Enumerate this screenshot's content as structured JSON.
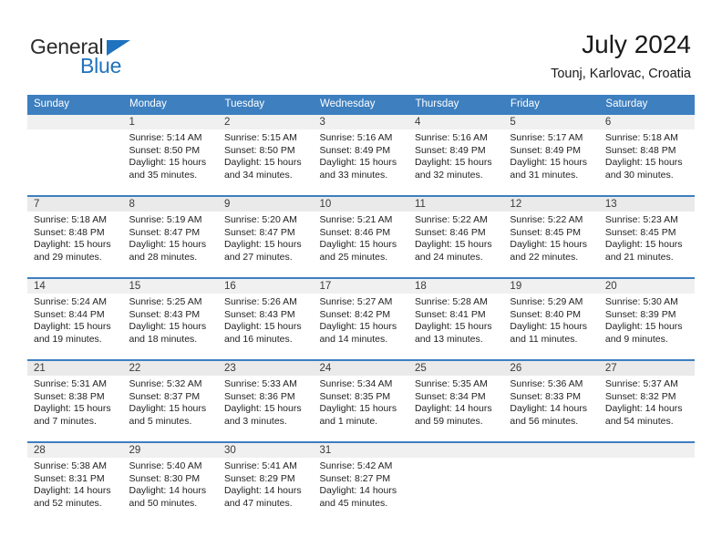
{
  "brand": {
    "name_part1": "General",
    "name_part2": "Blue",
    "accent_color": "#1f72bd"
  },
  "header": {
    "title": "July 2024",
    "subtitle": "Tounj, Karlovac, Croatia"
  },
  "calendar": {
    "header_color": "#3d7fbf",
    "weekdays": [
      "Sunday",
      "Monday",
      "Tuesday",
      "Wednesday",
      "Thursday",
      "Friday",
      "Saturday"
    ],
    "weeks": [
      [
        {
          "day": "",
          "sunrise": "",
          "sunset": "",
          "daylight_1": "",
          "daylight_2": ""
        },
        {
          "day": "1",
          "sunrise": "Sunrise: 5:14 AM",
          "sunset": "Sunset: 8:50 PM",
          "daylight_1": "Daylight: 15 hours",
          "daylight_2": "and 35 minutes."
        },
        {
          "day": "2",
          "sunrise": "Sunrise: 5:15 AM",
          "sunset": "Sunset: 8:50 PM",
          "daylight_1": "Daylight: 15 hours",
          "daylight_2": "and 34 minutes."
        },
        {
          "day": "3",
          "sunrise": "Sunrise: 5:16 AM",
          "sunset": "Sunset: 8:49 PM",
          "daylight_1": "Daylight: 15 hours",
          "daylight_2": "and 33 minutes."
        },
        {
          "day": "4",
          "sunrise": "Sunrise: 5:16 AM",
          "sunset": "Sunset: 8:49 PM",
          "daylight_1": "Daylight: 15 hours",
          "daylight_2": "and 32 minutes."
        },
        {
          "day": "5",
          "sunrise": "Sunrise: 5:17 AM",
          "sunset": "Sunset: 8:49 PM",
          "daylight_1": "Daylight: 15 hours",
          "daylight_2": "and 31 minutes."
        },
        {
          "day": "6",
          "sunrise": "Sunrise: 5:18 AM",
          "sunset": "Sunset: 8:48 PM",
          "daylight_1": "Daylight: 15 hours",
          "daylight_2": "and 30 minutes."
        }
      ],
      [
        {
          "day": "7",
          "sunrise": "Sunrise: 5:18 AM",
          "sunset": "Sunset: 8:48 PM",
          "daylight_1": "Daylight: 15 hours",
          "daylight_2": "and 29 minutes."
        },
        {
          "day": "8",
          "sunrise": "Sunrise: 5:19 AM",
          "sunset": "Sunset: 8:47 PM",
          "daylight_1": "Daylight: 15 hours",
          "daylight_2": "and 28 minutes."
        },
        {
          "day": "9",
          "sunrise": "Sunrise: 5:20 AM",
          "sunset": "Sunset: 8:47 PM",
          "daylight_1": "Daylight: 15 hours",
          "daylight_2": "and 27 minutes."
        },
        {
          "day": "10",
          "sunrise": "Sunrise: 5:21 AM",
          "sunset": "Sunset: 8:46 PM",
          "daylight_1": "Daylight: 15 hours",
          "daylight_2": "and 25 minutes."
        },
        {
          "day": "11",
          "sunrise": "Sunrise: 5:22 AM",
          "sunset": "Sunset: 8:46 PM",
          "daylight_1": "Daylight: 15 hours",
          "daylight_2": "and 24 minutes."
        },
        {
          "day": "12",
          "sunrise": "Sunrise: 5:22 AM",
          "sunset": "Sunset: 8:45 PM",
          "daylight_1": "Daylight: 15 hours",
          "daylight_2": "and 22 minutes."
        },
        {
          "day": "13",
          "sunrise": "Sunrise: 5:23 AM",
          "sunset": "Sunset: 8:45 PM",
          "daylight_1": "Daylight: 15 hours",
          "daylight_2": "and 21 minutes."
        }
      ],
      [
        {
          "day": "14",
          "sunrise": "Sunrise: 5:24 AM",
          "sunset": "Sunset: 8:44 PM",
          "daylight_1": "Daylight: 15 hours",
          "daylight_2": "and 19 minutes."
        },
        {
          "day": "15",
          "sunrise": "Sunrise: 5:25 AM",
          "sunset": "Sunset: 8:43 PM",
          "daylight_1": "Daylight: 15 hours",
          "daylight_2": "and 18 minutes."
        },
        {
          "day": "16",
          "sunrise": "Sunrise: 5:26 AM",
          "sunset": "Sunset: 8:43 PM",
          "daylight_1": "Daylight: 15 hours",
          "daylight_2": "and 16 minutes."
        },
        {
          "day": "17",
          "sunrise": "Sunrise: 5:27 AM",
          "sunset": "Sunset: 8:42 PM",
          "daylight_1": "Daylight: 15 hours",
          "daylight_2": "and 14 minutes."
        },
        {
          "day": "18",
          "sunrise": "Sunrise: 5:28 AM",
          "sunset": "Sunset: 8:41 PM",
          "daylight_1": "Daylight: 15 hours",
          "daylight_2": "and 13 minutes."
        },
        {
          "day": "19",
          "sunrise": "Sunrise: 5:29 AM",
          "sunset": "Sunset: 8:40 PM",
          "daylight_1": "Daylight: 15 hours",
          "daylight_2": "and 11 minutes."
        },
        {
          "day": "20",
          "sunrise": "Sunrise: 5:30 AM",
          "sunset": "Sunset: 8:39 PM",
          "daylight_1": "Daylight: 15 hours",
          "daylight_2": "and 9 minutes."
        }
      ],
      [
        {
          "day": "21",
          "sunrise": "Sunrise: 5:31 AM",
          "sunset": "Sunset: 8:38 PM",
          "daylight_1": "Daylight: 15 hours",
          "daylight_2": "and 7 minutes."
        },
        {
          "day": "22",
          "sunrise": "Sunrise: 5:32 AM",
          "sunset": "Sunset: 8:37 PM",
          "daylight_1": "Daylight: 15 hours",
          "daylight_2": "and 5 minutes."
        },
        {
          "day": "23",
          "sunrise": "Sunrise: 5:33 AM",
          "sunset": "Sunset: 8:36 PM",
          "daylight_1": "Daylight: 15 hours",
          "daylight_2": "and 3 minutes."
        },
        {
          "day": "24",
          "sunrise": "Sunrise: 5:34 AM",
          "sunset": "Sunset: 8:35 PM",
          "daylight_1": "Daylight: 15 hours",
          "daylight_2": "and 1 minute."
        },
        {
          "day": "25",
          "sunrise": "Sunrise: 5:35 AM",
          "sunset": "Sunset: 8:34 PM",
          "daylight_1": "Daylight: 14 hours",
          "daylight_2": "and 59 minutes."
        },
        {
          "day": "26",
          "sunrise": "Sunrise: 5:36 AM",
          "sunset": "Sunset: 8:33 PM",
          "daylight_1": "Daylight: 14 hours",
          "daylight_2": "and 56 minutes."
        },
        {
          "day": "27",
          "sunrise": "Sunrise: 5:37 AM",
          "sunset": "Sunset: 8:32 PM",
          "daylight_1": "Daylight: 14 hours",
          "daylight_2": "and 54 minutes."
        }
      ],
      [
        {
          "day": "28",
          "sunrise": "Sunrise: 5:38 AM",
          "sunset": "Sunset: 8:31 PM",
          "daylight_1": "Daylight: 14 hours",
          "daylight_2": "and 52 minutes."
        },
        {
          "day": "29",
          "sunrise": "Sunrise: 5:40 AM",
          "sunset": "Sunset: 8:30 PM",
          "daylight_1": "Daylight: 14 hours",
          "daylight_2": "and 50 minutes."
        },
        {
          "day": "30",
          "sunrise": "Sunrise: 5:41 AM",
          "sunset": "Sunset: 8:29 PM",
          "daylight_1": "Daylight: 14 hours",
          "daylight_2": "and 47 minutes."
        },
        {
          "day": "31",
          "sunrise": "Sunrise: 5:42 AM",
          "sunset": "Sunset: 8:27 PM",
          "daylight_1": "Daylight: 14 hours",
          "daylight_2": "and 45 minutes."
        },
        {
          "day": "",
          "sunrise": "",
          "sunset": "",
          "daylight_1": "",
          "daylight_2": ""
        },
        {
          "day": "",
          "sunrise": "",
          "sunset": "",
          "daylight_1": "",
          "daylight_2": ""
        },
        {
          "day": "",
          "sunrise": "",
          "sunset": "",
          "daylight_1": "",
          "daylight_2": ""
        }
      ]
    ]
  }
}
